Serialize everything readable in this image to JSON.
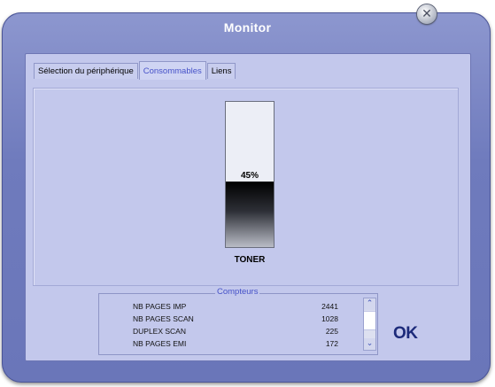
{
  "window": {
    "title": "Monitor"
  },
  "tabs": [
    {
      "label": "Sélection du périphérique",
      "active": false
    },
    {
      "label": "Consommables",
      "active": true
    },
    {
      "label": "Liens",
      "active": false
    }
  ],
  "toner": {
    "label": "TONER",
    "level_percent": 45,
    "level_text": "45%"
  },
  "counters": {
    "legend": "Compteurs",
    "rows": [
      {
        "label": "NB PAGES IMP",
        "value": "2441"
      },
      {
        "label": "NB PAGES SCAN",
        "value": "1028"
      },
      {
        "label": "DUPLEX SCAN",
        "value": "225"
      },
      {
        "label": "NB PAGES EMI",
        "value": "172"
      }
    ]
  },
  "buttons": {
    "ok": "OK",
    "close_icon": "close-x-icon"
  },
  "colors": {
    "accent": "#4652c8",
    "frame": "#7a85c4",
    "panel": "#c3c8ec"
  }
}
